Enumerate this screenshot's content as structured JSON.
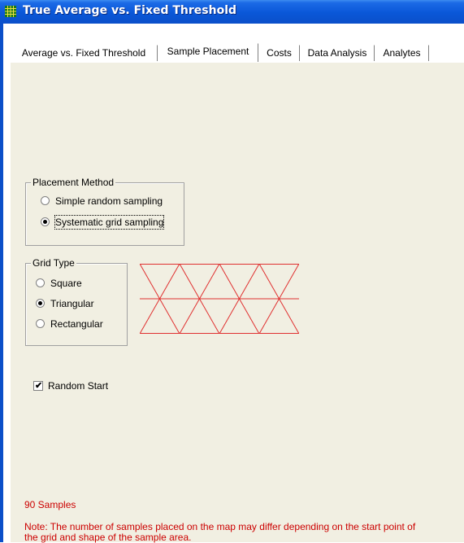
{
  "window": {
    "title": "True Average vs. Fixed Threshold",
    "icon": "grid-icon"
  },
  "tabs": [
    {
      "label": "Average vs. Fixed Threshold",
      "active": false
    },
    {
      "label": "Sample Placement",
      "active": true
    },
    {
      "label": "Costs",
      "active": false
    },
    {
      "label": "Data Analysis",
      "active": false
    },
    {
      "label": "Analytes",
      "active": false
    }
  ],
  "placement_method": {
    "legend": "Placement Method",
    "options": [
      {
        "label": "Simple random sampling",
        "checked": false
      },
      {
        "label": "Systematic grid sampling",
        "checked": true
      }
    ]
  },
  "grid_type": {
    "legend": "Grid Type",
    "options": [
      {
        "label": "Square",
        "checked": false
      },
      {
        "label": "Triangular",
        "checked": true
      },
      {
        "label": "Rectangular",
        "checked": false
      }
    ],
    "preview_color": "#e03030"
  },
  "random_start": {
    "label": "Random Start",
    "checked": true
  },
  "status": {
    "samples": "90 Samples",
    "note_line1": "Note:  The number of samples placed on the map may differ depending on the start point of",
    "note_line2": "the grid and shape of the sample area."
  },
  "colors": {
    "titlebar": "#0b4fc9",
    "panel": "#f1efe2",
    "note_text": "#cc0000"
  }
}
